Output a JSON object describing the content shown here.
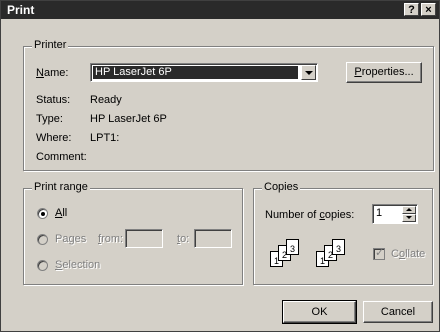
{
  "window": {
    "title": "Print",
    "help_button": "?",
    "close_button": "×"
  },
  "printer": {
    "group_label": "Printer",
    "name_label": "Name:",
    "name_value": "HP LaserJet 6P",
    "properties_button": "Properties...",
    "status_label": "Status:",
    "status_value": "Ready",
    "type_label": "Type:",
    "type_value": "HP LaserJet 6P",
    "where_label": "Where:",
    "where_value": "LPT1:",
    "comment_label": "Comment:",
    "comment_value": ""
  },
  "print_range": {
    "group_label": "Print range",
    "all_label": "All",
    "pages_label": "Pages",
    "from_label": "from:",
    "to_label": "to:",
    "from_value": "",
    "to_value": "",
    "selection_label": "Selection",
    "selected": "All"
  },
  "copies": {
    "group_label": "Copies",
    "number_label": "Number of copies:",
    "number_value": "1",
    "collate_label": "Collate",
    "collate_checked": true,
    "collate_icon_pages": [
      "1",
      "2",
      "3"
    ]
  },
  "buttons": {
    "ok": "OK",
    "cancel": "Cancel"
  }
}
